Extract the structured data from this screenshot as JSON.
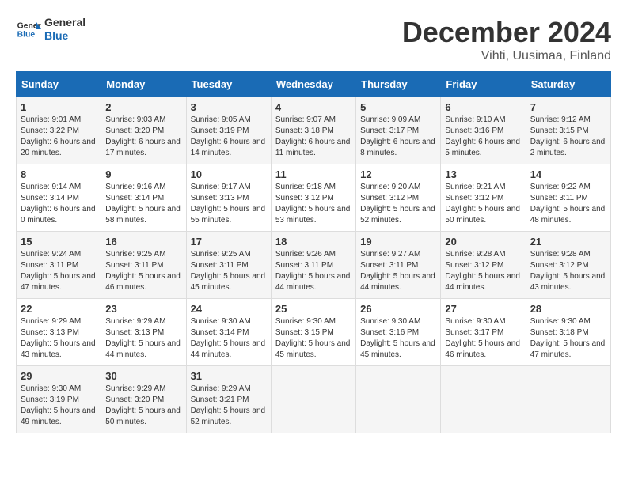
{
  "header": {
    "logo_general": "General",
    "logo_blue": "Blue",
    "month_title": "December 2024",
    "location": "Vihti, Uusimaa, Finland"
  },
  "days_of_week": [
    "Sunday",
    "Monday",
    "Tuesday",
    "Wednesday",
    "Thursday",
    "Friday",
    "Saturday"
  ],
  "weeks": [
    [
      {
        "day": "1",
        "sunrise": "9:01 AM",
        "sunset": "3:22 PM",
        "daylight": "6 hours and 20 minutes."
      },
      {
        "day": "2",
        "sunrise": "9:03 AM",
        "sunset": "3:20 PM",
        "daylight": "6 hours and 17 minutes."
      },
      {
        "day": "3",
        "sunrise": "9:05 AM",
        "sunset": "3:19 PM",
        "daylight": "6 hours and 14 minutes."
      },
      {
        "day": "4",
        "sunrise": "9:07 AM",
        "sunset": "3:18 PM",
        "daylight": "6 hours and 11 minutes."
      },
      {
        "day": "5",
        "sunrise": "9:09 AM",
        "sunset": "3:17 PM",
        "daylight": "6 hours and 8 minutes."
      },
      {
        "day": "6",
        "sunrise": "9:10 AM",
        "sunset": "3:16 PM",
        "daylight": "6 hours and 5 minutes."
      },
      {
        "day": "7",
        "sunrise": "9:12 AM",
        "sunset": "3:15 PM",
        "daylight": "6 hours and 2 minutes."
      }
    ],
    [
      {
        "day": "8",
        "sunrise": "9:14 AM",
        "sunset": "3:14 PM",
        "daylight": "6 hours and 0 minutes."
      },
      {
        "day": "9",
        "sunrise": "9:16 AM",
        "sunset": "3:14 PM",
        "daylight": "5 hours and 58 minutes."
      },
      {
        "day": "10",
        "sunrise": "9:17 AM",
        "sunset": "3:13 PM",
        "daylight": "5 hours and 55 minutes."
      },
      {
        "day": "11",
        "sunrise": "9:18 AM",
        "sunset": "3:12 PM",
        "daylight": "5 hours and 53 minutes."
      },
      {
        "day": "12",
        "sunrise": "9:20 AM",
        "sunset": "3:12 PM",
        "daylight": "5 hours and 52 minutes."
      },
      {
        "day": "13",
        "sunrise": "9:21 AM",
        "sunset": "3:12 PM",
        "daylight": "5 hours and 50 minutes."
      },
      {
        "day": "14",
        "sunrise": "9:22 AM",
        "sunset": "3:11 PM",
        "daylight": "5 hours and 48 minutes."
      }
    ],
    [
      {
        "day": "15",
        "sunrise": "9:24 AM",
        "sunset": "3:11 PM",
        "daylight": "5 hours and 47 minutes."
      },
      {
        "day": "16",
        "sunrise": "9:25 AM",
        "sunset": "3:11 PM",
        "daylight": "5 hours and 46 minutes."
      },
      {
        "day": "17",
        "sunrise": "9:25 AM",
        "sunset": "3:11 PM",
        "daylight": "5 hours and 45 minutes."
      },
      {
        "day": "18",
        "sunrise": "9:26 AM",
        "sunset": "3:11 PM",
        "daylight": "5 hours and 44 minutes."
      },
      {
        "day": "19",
        "sunrise": "9:27 AM",
        "sunset": "3:11 PM",
        "daylight": "5 hours and 44 minutes."
      },
      {
        "day": "20",
        "sunrise": "9:28 AM",
        "sunset": "3:12 PM",
        "daylight": "5 hours and 44 minutes."
      },
      {
        "day": "21",
        "sunrise": "9:28 AM",
        "sunset": "3:12 PM",
        "daylight": "5 hours and 43 minutes."
      }
    ],
    [
      {
        "day": "22",
        "sunrise": "9:29 AM",
        "sunset": "3:13 PM",
        "daylight": "5 hours and 43 minutes."
      },
      {
        "day": "23",
        "sunrise": "9:29 AM",
        "sunset": "3:13 PM",
        "daylight": "5 hours and 44 minutes."
      },
      {
        "day": "24",
        "sunrise": "9:30 AM",
        "sunset": "3:14 PM",
        "daylight": "5 hours and 44 minutes."
      },
      {
        "day": "25",
        "sunrise": "9:30 AM",
        "sunset": "3:15 PM",
        "daylight": "5 hours and 45 minutes."
      },
      {
        "day": "26",
        "sunrise": "9:30 AM",
        "sunset": "3:16 PM",
        "daylight": "5 hours and 45 minutes."
      },
      {
        "day": "27",
        "sunrise": "9:30 AM",
        "sunset": "3:17 PM",
        "daylight": "5 hours and 46 minutes."
      },
      {
        "day": "28",
        "sunrise": "9:30 AM",
        "sunset": "3:18 PM",
        "daylight": "5 hours and 47 minutes."
      }
    ],
    [
      {
        "day": "29",
        "sunrise": "9:30 AM",
        "sunset": "3:19 PM",
        "daylight": "5 hours and 49 minutes."
      },
      {
        "day": "30",
        "sunrise": "9:29 AM",
        "sunset": "3:20 PM",
        "daylight": "5 hours and 50 minutes."
      },
      {
        "day": "31",
        "sunrise": "9:29 AM",
        "sunset": "3:21 PM",
        "daylight": "5 hours and 52 minutes."
      },
      null,
      null,
      null,
      null
    ]
  ]
}
